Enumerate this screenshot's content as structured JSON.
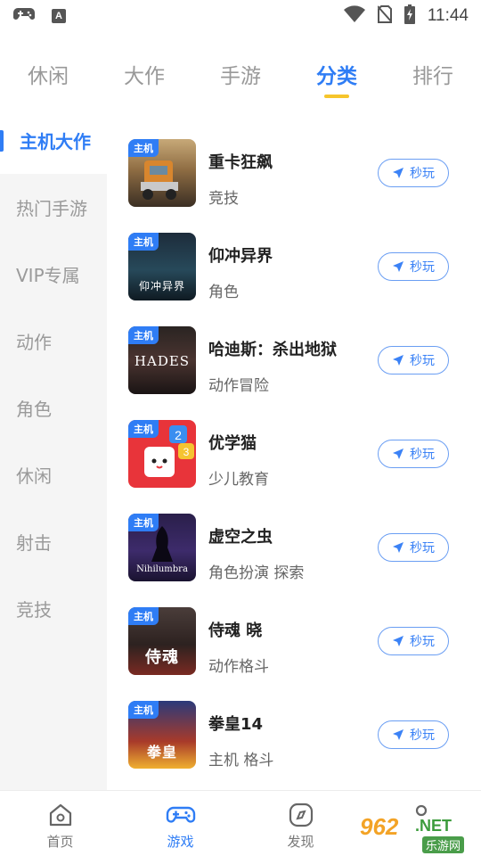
{
  "status_bar": {
    "time": "11:44",
    "a_badge": "A"
  },
  "top_tabs": [
    {
      "label": "休闲"
    },
    {
      "label": "大作"
    },
    {
      "label": "手游"
    },
    {
      "label": "分类"
    },
    {
      "label": "排行"
    }
  ],
  "active_top_tab": "分类",
  "sidebar": {
    "items": [
      {
        "label": "主机大作"
      },
      {
        "label": "热门手游"
      },
      {
        "label": "VIP专属"
      },
      {
        "label": "动作"
      },
      {
        "label": "角色"
      },
      {
        "label": "休闲"
      },
      {
        "label": "射击"
      },
      {
        "label": "竞技"
      }
    ],
    "active": "主机大作"
  },
  "games": [
    {
      "tag": "主机",
      "name": "重卡狂飙",
      "category": "竞技",
      "art_text": "",
      "play_label": "秒玩"
    },
    {
      "tag": "主机",
      "name": "仰冲异界",
      "category": "角色",
      "art_text": "仰冲异界",
      "play_label": "秒玩"
    },
    {
      "tag": "主机",
      "name": "哈迪斯：杀出地狱",
      "category": "动作冒险",
      "art_text": "HADES",
      "play_label": "秒玩"
    },
    {
      "tag": "主机",
      "name": "优学猫",
      "category": "少儿教育",
      "art_text": "",
      "play_label": "秒玩"
    },
    {
      "tag": "主机",
      "name": "虚空之虫",
      "category": "角色扮演   探索",
      "art_text": "Nihilumbra",
      "play_label": "秒玩"
    },
    {
      "tag": "主机",
      "name": "侍魂 晓",
      "category": "动作格斗",
      "art_text": "侍魂",
      "play_label": "秒玩"
    },
    {
      "tag": "主机",
      "name": "拳皇14",
      "category": "主机   格斗",
      "art_text": "拳皇",
      "play_label": "秒玩"
    }
  ],
  "bottom_nav": [
    {
      "label": "首页"
    },
    {
      "label": "游戏"
    },
    {
      "label": "发现"
    },
    {
      "label": ""
    }
  ],
  "active_bottom_nav": "游戏",
  "watermark": {
    "num": "962",
    "net": ".NET",
    "cn": "乐游网"
  },
  "colors": {
    "accent": "#2f7df5",
    "indicator": "#f6c52b",
    "sidebar_bg": "#f5f5f5"
  }
}
